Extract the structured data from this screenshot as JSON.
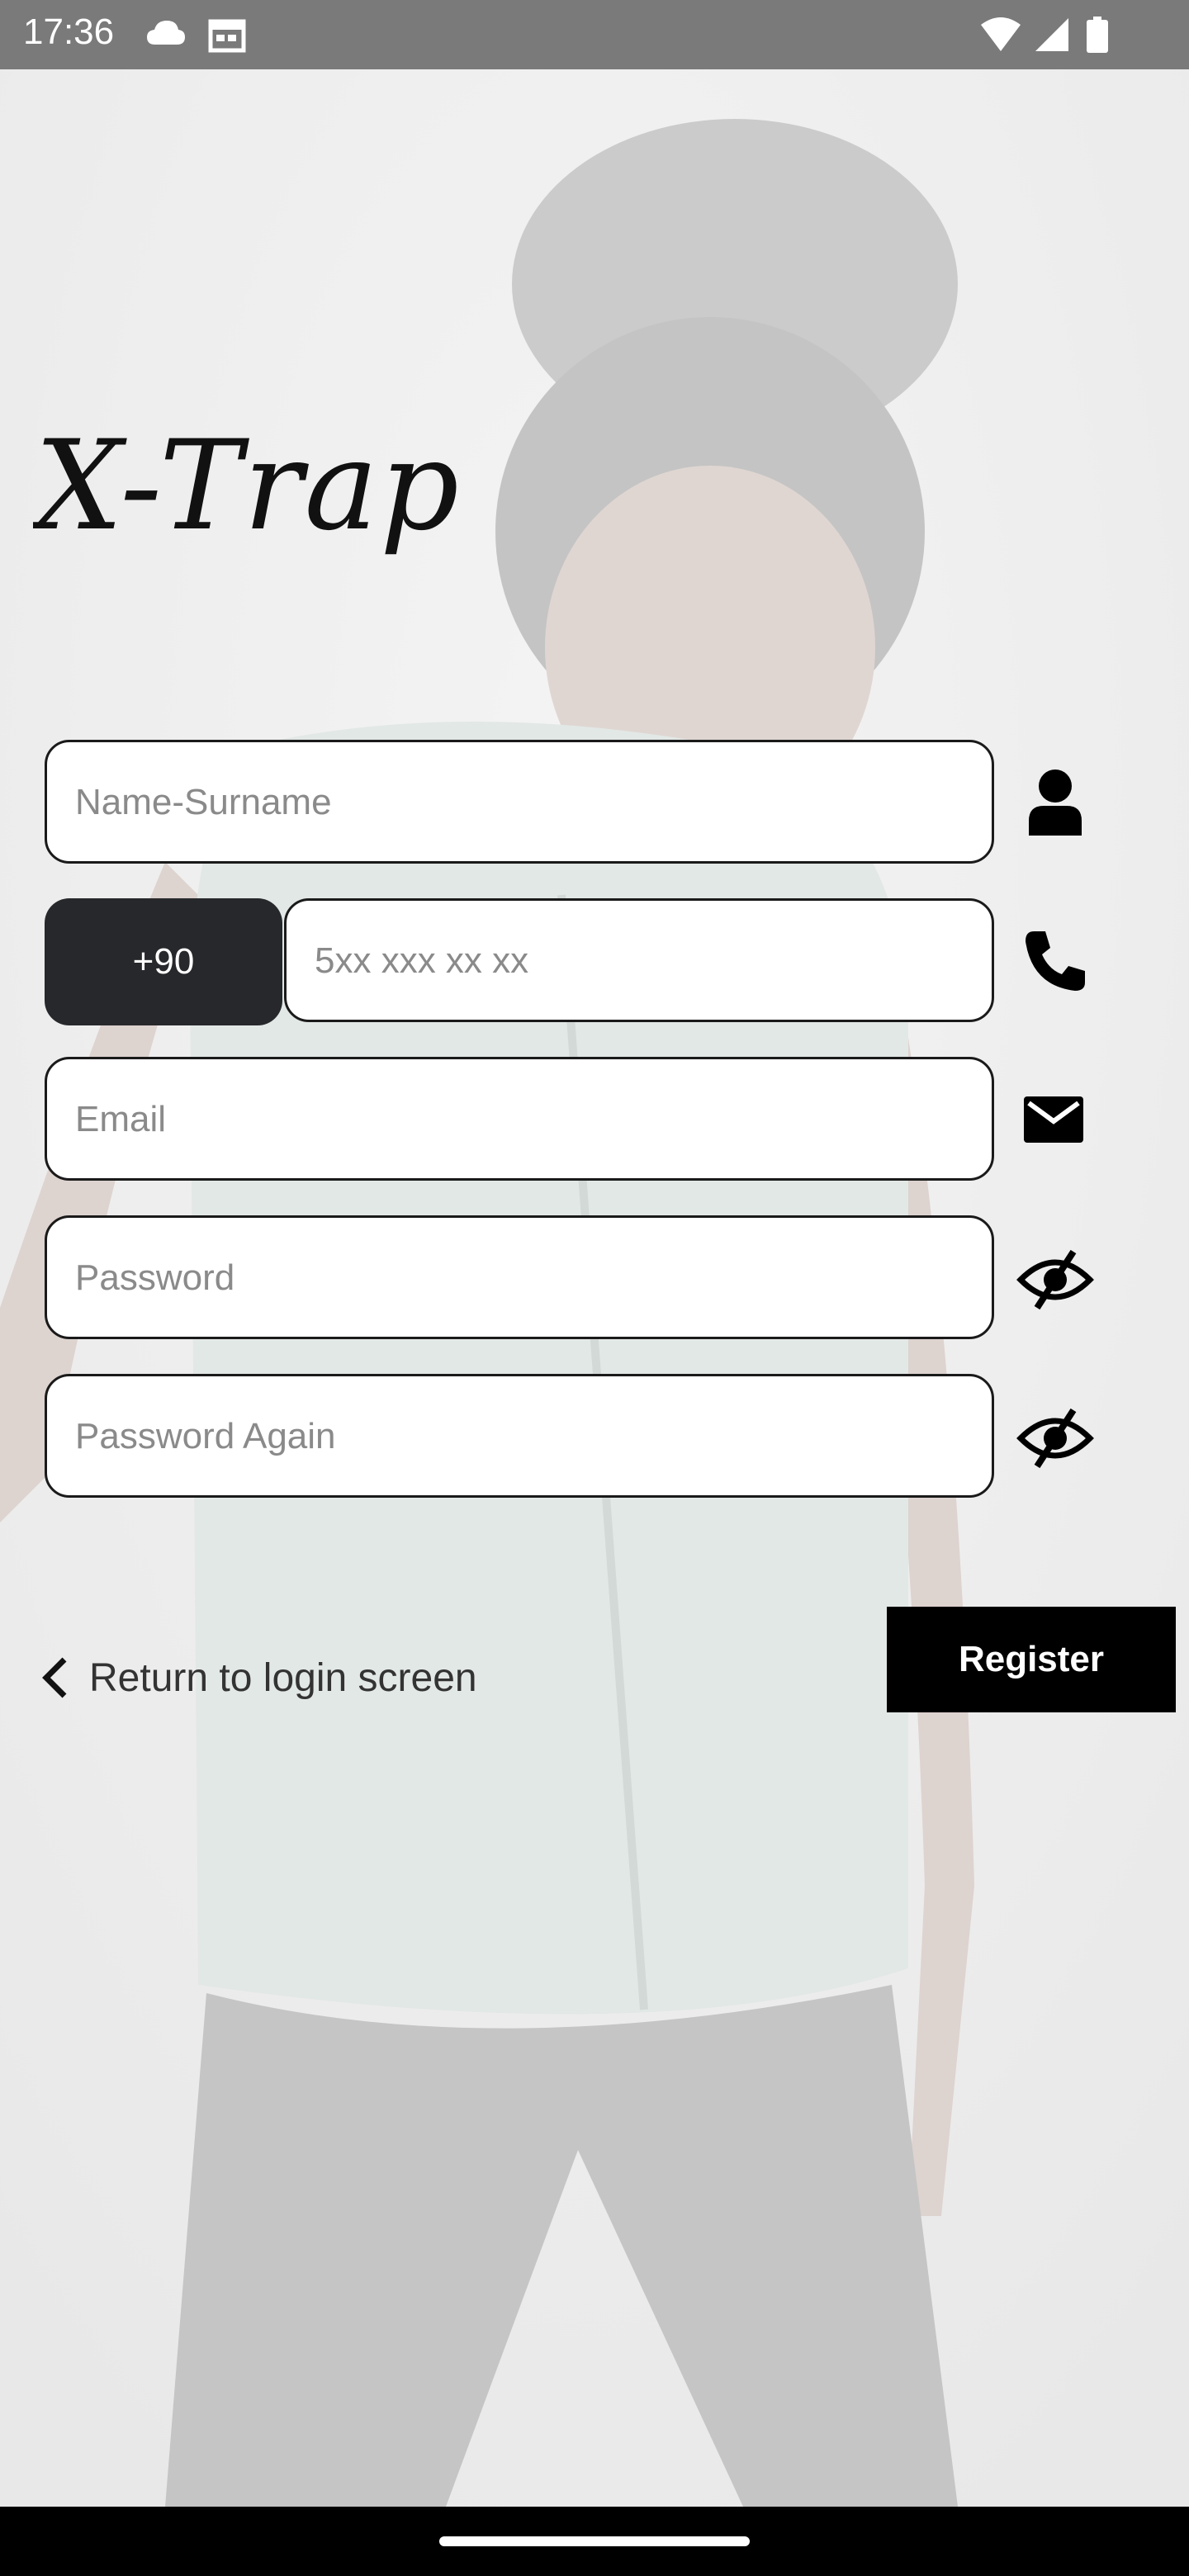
{
  "status_bar": {
    "time": "17:36",
    "icons": [
      "cloud-icon",
      "calendar-icon",
      "wifi-icon",
      "signal-icon",
      "battery-icon"
    ]
  },
  "logo": {
    "text": "X-Trap"
  },
  "form": {
    "name": {
      "placeholder": "Name-Surname",
      "value": "",
      "icon": "person-icon"
    },
    "phone": {
      "country_code": "+90",
      "placeholder": "5xx xxx xx xx",
      "value": "",
      "icon": "phone-icon"
    },
    "email": {
      "placeholder": "Email",
      "value": "",
      "icon": "mail-icon"
    },
    "password": {
      "placeholder": "Password",
      "value": "",
      "icon": "eye-off-icon"
    },
    "password_again": {
      "placeholder": "Password Again",
      "value": "",
      "icon": "eye-off-icon"
    }
  },
  "actions": {
    "back_label": "Return to login screen",
    "register_label": "Register"
  },
  "colors": {
    "status_bar": "#7a7a7a",
    "country_code_bg": "#27282b",
    "button_bg": "#000000",
    "field_border": "#1a1a1a"
  }
}
